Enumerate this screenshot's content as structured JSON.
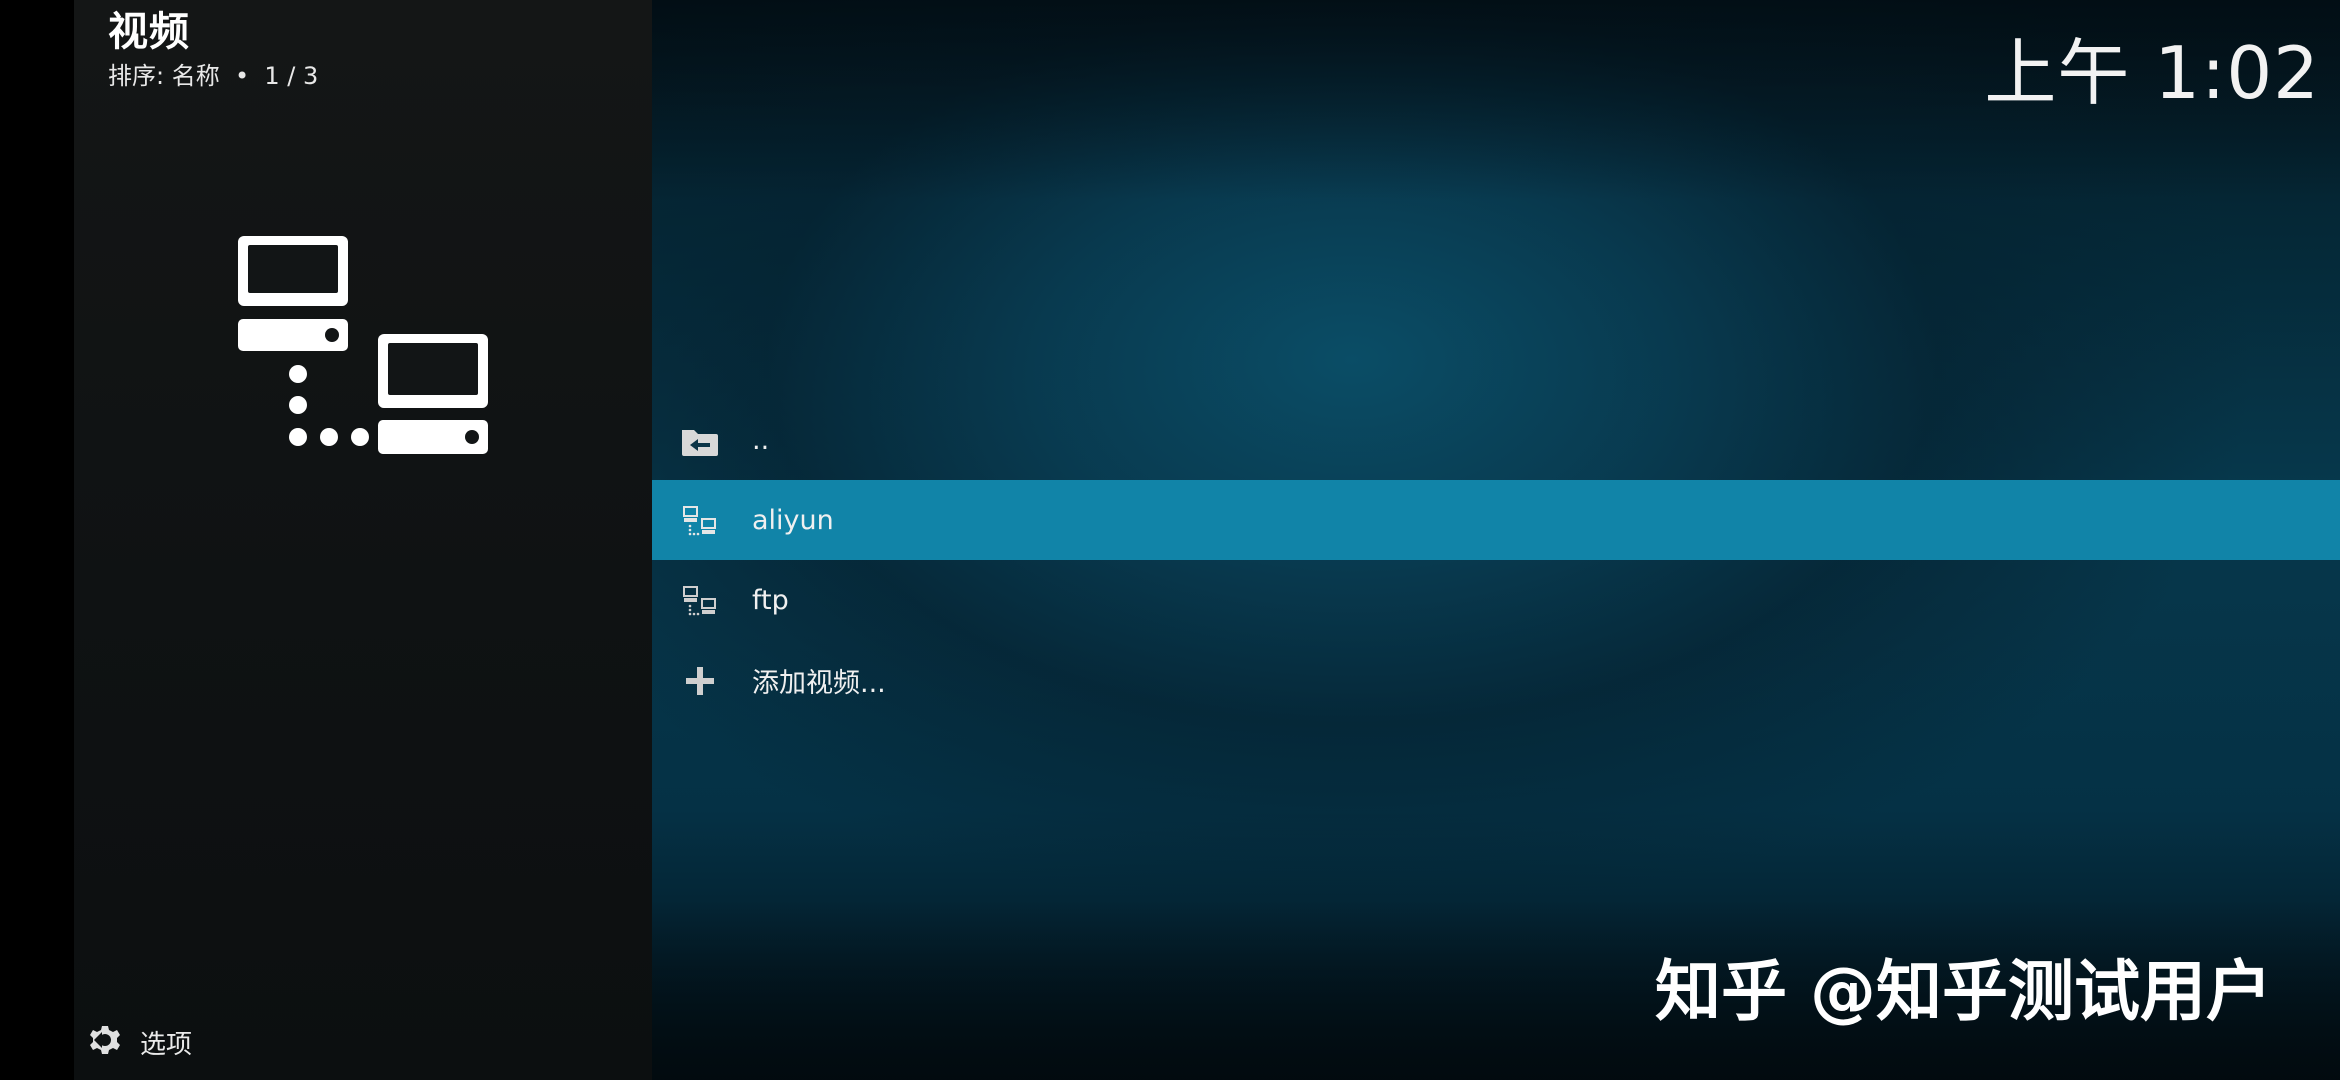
{
  "header": {
    "title": "视频",
    "sort_info": "排序: 名称  •  1 / 3",
    "clock": "上午 1:02"
  },
  "sidebar": {
    "art_icon": "network-computers-icon",
    "options_icon": "options-gear-icon",
    "options_label": "选项"
  },
  "list": {
    "items": [
      {
        "label": "..",
        "icon": "folder-back-icon",
        "selected": false
      },
      {
        "label": "aliyun",
        "icon": "network-source-icon",
        "selected": true
      },
      {
        "label": "ftp",
        "icon": "network-source-icon",
        "selected": false
      },
      {
        "label": "添加视频...",
        "icon": "plus-icon",
        "selected": false
      }
    ]
  },
  "watermark": "知乎 @知乎测试用户",
  "colors": {
    "accent_selected": "#1184a8",
    "sidebar_bg": "#121516",
    "main_bg": "#063a50"
  }
}
